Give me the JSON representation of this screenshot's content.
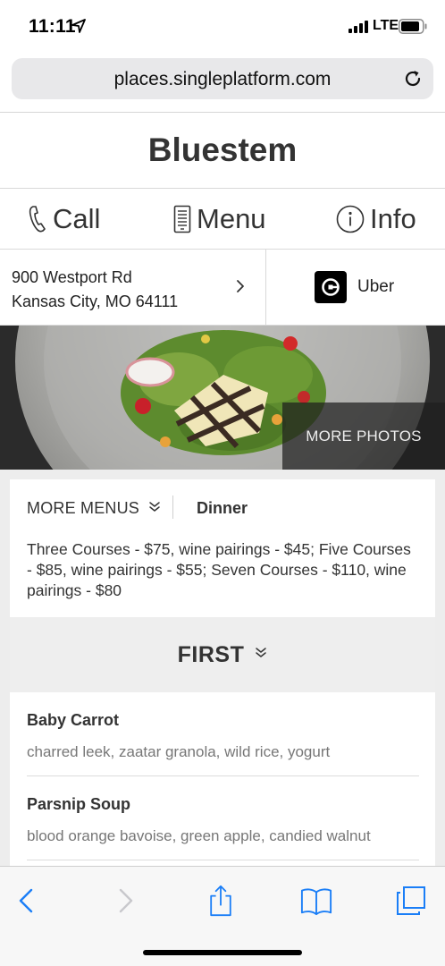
{
  "status_bar": {
    "time": "11:11",
    "network": "LTE",
    "icons": [
      "location-arrow-icon",
      "signal-icon",
      "battery-icon"
    ]
  },
  "browser": {
    "url": "places.singleplatform.com",
    "reload_icon": "reload-icon"
  },
  "restaurant": {
    "name": "Bluestem"
  },
  "actions": {
    "call": "Call",
    "menu": "Menu",
    "info": "Info"
  },
  "address": {
    "line1": "900 Westport Rd",
    "line2": "Kansas City, MO 64111"
  },
  "uber": {
    "label": "Uber"
  },
  "photo": {
    "more_photos": "MORE PHOTOS"
  },
  "menu": {
    "more_menus": "MORE MENUS",
    "current": "Dinner",
    "description": "Three Courses - $75, wine pairings - $45; Five Courses - $85, wine pairings - $55; Seven Courses - $110, wine pairings - $80",
    "section": "FIRST",
    "items": [
      {
        "name": "Baby Carrot",
        "description": "charred leek, zaatar granola, wild rice, yogurt"
      },
      {
        "name": "Parsnip Soup",
        "description": "blood orange bavoise, green apple, candied walnut"
      }
    ]
  },
  "colors": {
    "ios_blue": "#1a7ef7",
    "panel_bg": "#ededed",
    "text_dark": "#333333",
    "text_muted": "#777777"
  }
}
